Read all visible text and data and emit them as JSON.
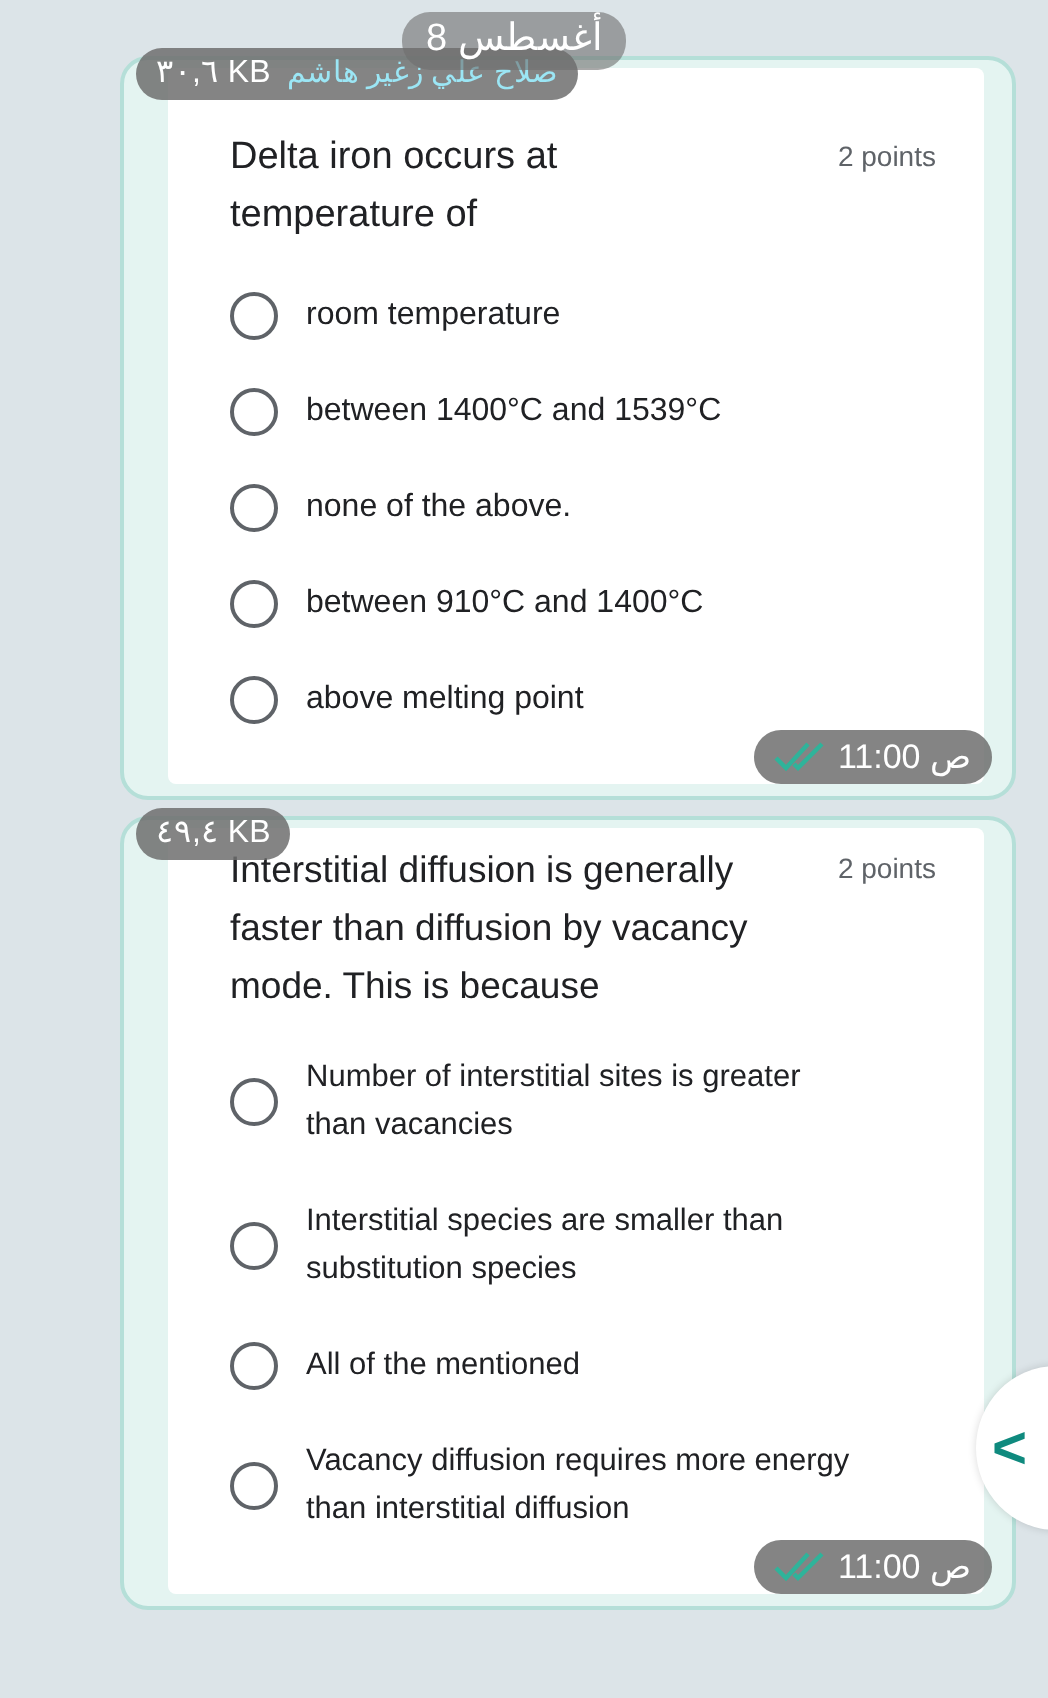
{
  "date_pill": "8 أغسطس",
  "messages": [
    {
      "file_size": "٣٠,٦ KB",
      "sender": "صلاح علي زغير هاشم",
      "question": "Delta iron occurs at temperature of",
      "points": "2 points",
      "options": [
        {
          "label": "room temperature",
          "selected": false
        },
        {
          "label": "between 1400°C and 1539°C",
          "selected": false
        },
        {
          "label": "none of the above.",
          "selected": false
        },
        {
          "label": "between 910°C and 1400°C",
          "selected": false
        },
        {
          "label": "above melting point",
          "selected": false
        }
      ],
      "time": "11:00 ص",
      "read": true
    },
    {
      "file_size": "٤٩,٤ KB",
      "question": "Interstitial diffusion is generally faster than diffusion by vacancy mode. This is because",
      "points": "2 points",
      "options": [
        {
          "label": "Number of interstitial sites is greater than vacancies",
          "selected": false
        },
        {
          "label": "Interstitial species are smaller than substitution species",
          "selected": false
        },
        {
          "label": "All of the mentioned",
          "selected": false
        },
        {
          "label": "Vacancy diffusion requires more energy than interstitial diffusion",
          "selected": false
        }
      ],
      "time": "11:00 ص",
      "read": true
    }
  ],
  "side_button": "<"
}
